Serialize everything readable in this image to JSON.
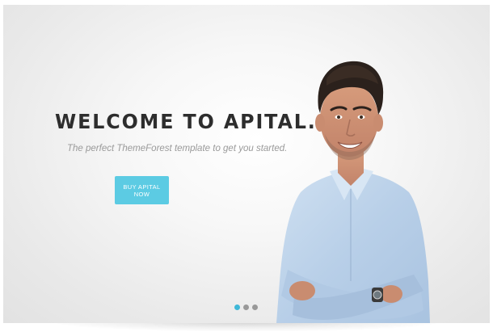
{
  "hero": {
    "headline": "WELCOME TO APITAL.",
    "subline": "The perfect ThemeForest template to get you started.",
    "cta_label": "BUY APITAL NOW"
  },
  "slider": {
    "slides": [
      {
        "active": true
      },
      {
        "active": false
      },
      {
        "active": false
      }
    ]
  },
  "colors": {
    "accent": "#5ccbe3",
    "active_dot": "#3fb8d8",
    "inactive_dot": "#999999",
    "headline": "#2d2d2d",
    "subline": "#9a9a9a"
  },
  "icons": {
    "hero_image": "man-in-blue-shirt-portrait"
  }
}
